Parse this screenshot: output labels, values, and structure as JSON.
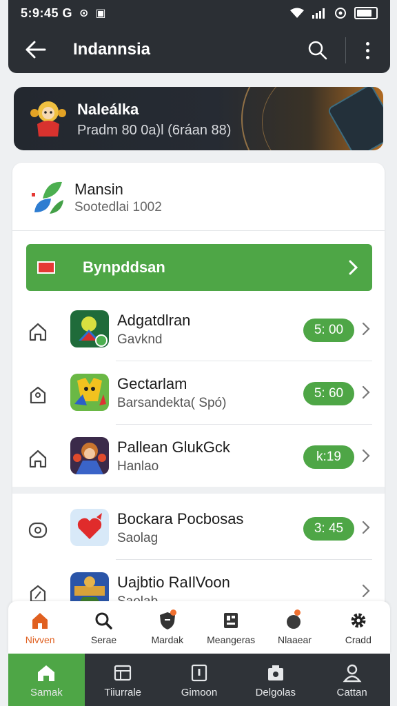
{
  "status": {
    "time": "5:9:45 G",
    "icons": [
      "sim-icon",
      "wifi-icon",
      "signal-icon",
      "hotspot-icon",
      "battery-icon"
    ]
  },
  "appbar": {
    "title": "Indannsia"
  },
  "banner": {
    "title": "Naleálka",
    "subtitle": "Pradm 80 0a)l (6ráan 88)"
  },
  "provider": {
    "name": "Mansin",
    "subtitle": "Sootedlai 1002"
  },
  "action": {
    "label": "Bynpddsan"
  },
  "list": [
    {
      "title": "Adgatdlran",
      "subtitle": "Gavknd",
      "time": "5: 00"
    },
    {
      "title": "Gectarlam",
      "subtitle": "Barsandekta( Spó)",
      "time": "5: 60"
    },
    {
      "title": "Pallean GlukGck",
      "subtitle": "Hanlao",
      "time": "k:19"
    },
    {
      "title": "Bockara Pocbosas",
      "subtitle": "Saolag",
      "time": "3: 45"
    },
    {
      "title": "Uajbtio RaIlVoon",
      "subtitle": "Saolab",
      "time": ""
    }
  ],
  "tabs": [
    {
      "label": "Nivven"
    },
    {
      "label": "Serae"
    },
    {
      "label": "Mardak"
    },
    {
      "label": "Meangeras"
    },
    {
      "label": "Nlaaear"
    },
    {
      "label": "Cradd"
    }
  ],
  "nav": [
    {
      "label": "Samak"
    },
    {
      "label": "Tiiurrale"
    },
    {
      "label": "Gimoon"
    },
    {
      "label": "Delgolas"
    },
    {
      "label": "Cattan"
    }
  ],
  "colors": {
    "accent": "#4ea646",
    "dark": "#2b2f34",
    "active_tab": "#e06020"
  }
}
